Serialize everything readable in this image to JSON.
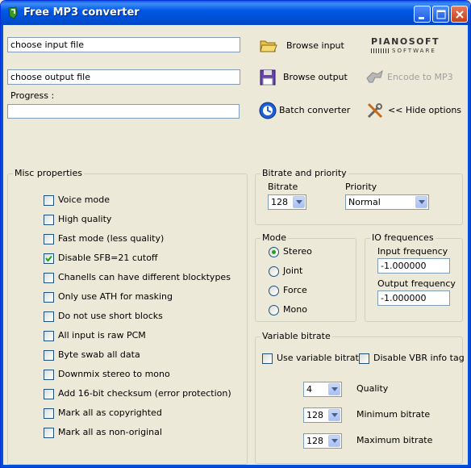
{
  "window": {
    "title": "Free MP3 converter"
  },
  "io": {
    "input_value": "choose input file",
    "output_value": "choose output file",
    "progress_label": "Progress :",
    "progress_value": ""
  },
  "actions": {
    "browse_input": "Browse input",
    "browse_output": "Browse output",
    "batch_converter": "Batch converter",
    "encode": "Encode to MP3",
    "hide_options": "<< Hide options"
  },
  "logo": {
    "line1": "PIANOSOFT",
    "line2": "SOFTWARE"
  },
  "misc": {
    "title": "Misc properties",
    "items": [
      {
        "label": "Voice mode",
        "checked": false
      },
      {
        "label": "High quality",
        "checked": false
      },
      {
        "label": "Fast mode (less quality)",
        "checked": false
      },
      {
        "label": "Disable SFB=21 cutoff",
        "checked": true
      },
      {
        "label": "Chanells can have different blocktypes",
        "checked": false
      },
      {
        "label": "Only use ATH for masking",
        "checked": false
      },
      {
        "label": "Do not use short blocks",
        "checked": false
      },
      {
        "label": "All input is raw PCM",
        "checked": false
      },
      {
        "label": "Byte swab all data",
        "checked": false
      },
      {
        "label": "Downmix stereo to mono",
        "checked": false
      },
      {
        "label": "Add 16-bit checksum (error protection)",
        "checked": false
      },
      {
        "label": "Mark all as copyrighted",
        "checked": false
      },
      {
        "label": "Mark all as non-original",
        "checked": false
      }
    ]
  },
  "bitrate_priority": {
    "title": "Bitrate and priority",
    "bitrate_label": "Bitrate",
    "bitrate_value": "128",
    "priority_label": "Priority",
    "priority_value": "Normal"
  },
  "mode": {
    "title": "Mode",
    "options": [
      "Stereo",
      "Joint",
      "Force",
      "Mono"
    ],
    "selected": "Stereo"
  },
  "io_freq": {
    "title": "IO frequences",
    "input_label": "Input frequency",
    "input_value": "-1.000000",
    "output_label": "Output frequency",
    "output_value": "-1.000000"
  },
  "vbr": {
    "title": "Variable bitrate",
    "use_vbr_label": "Use variable bitrate",
    "use_vbr_checked": false,
    "disable_info_label": "Disable VBR info tag",
    "disable_info_checked": false,
    "quality_value": "4",
    "quality_label": "Quality",
    "min_value": "128",
    "min_label": "Minimum bitrate",
    "max_value": "128",
    "max_label": "Maximum bitrate"
  }
}
